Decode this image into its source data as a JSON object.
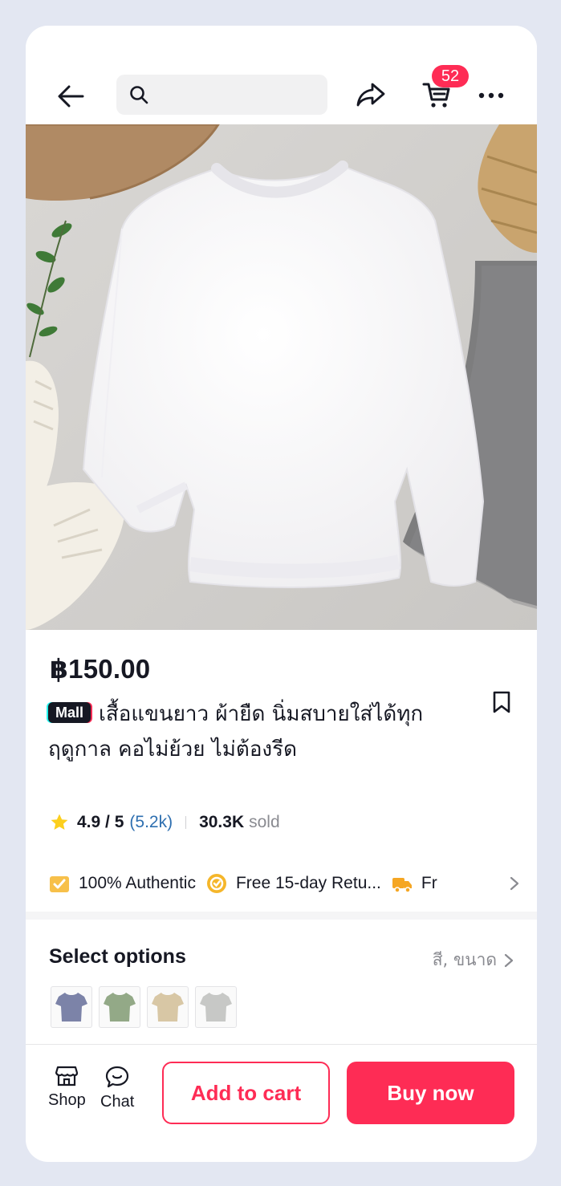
{
  "header": {
    "search_placeholder": "",
    "cart_badge": "52"
  },
  "product": {
    "price": "฿150.00",
    "mall_tag": "Mall",
    "title": "เสื้อแขนยาว ผ้ายืด นิ่มสบายใส่ได้ทุกฤดูกาล คอไม่ย้วย ไม่ต้องรีด",
    "rating": "4.9 / 5",
    "review_count": "(5.2k)",
    "sold_count": "30.3K",
    "sold_label": "sold"
  },
  "features": [
    {
      "label": "100% Authentic",
      "icon": "authentic-icon",
      "color": "#f7c04a"
    },
    {
      "label": "Free 15-day Retu...",
      "icon": "return-icon",
      "color": "#f5b62a"
    },
    {
      "label": "Fr",
      "icon": "shipping-icon",
      "color": "#f5a623"
    }
  ],
  "options": {
    "title": "Select options",
    "summary": "สี, ขนาด",
    "swatches": [
      {
        "name": "navy",
        "color": "#7c83a8"
      },
      {
        "name": "green",
        "color": "#93a987"
      },
      {
        "name": "beige",
        "color": "#d8c7a5"
      },
      {
        "name": "grey",
        "color": "#c7c8c6"
      }
    ]
  },
  "bottom_bar": {
    "shop_label": "Shop",
    "chat_label": "Chat",
    "add_to_cart": "Add to cart",
    "buy_now": "Buy now"
  },
  "colors": {
    "accent": "#fe2c55",
    "link": "#2e6fb0",
    "star": "#fccf1d"
  }
}
